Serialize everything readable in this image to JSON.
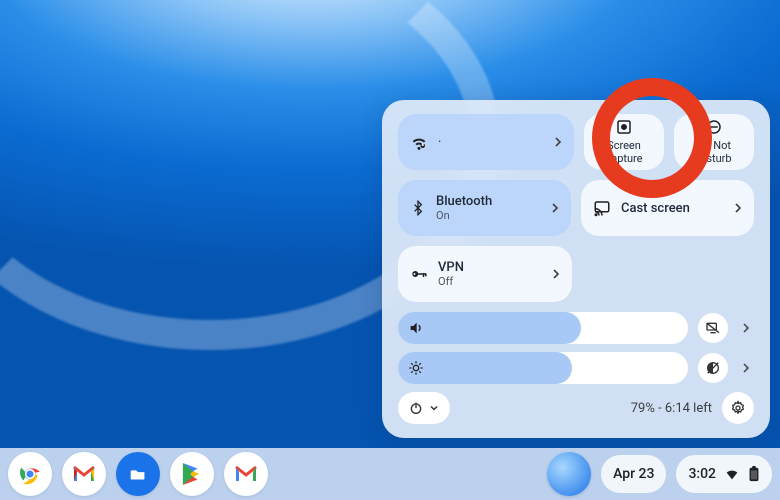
{
  "panel": {
    "tiles": {
      "wifi": {
        "name_placeholder": "·"
      },
      "screen_capture": {
        "label": "Screen capture"
      },
      "dnd": {
        "label": "Do Not Disturb"
      },
      "bluetooth": {
        "label": "Bluetooth",
        "state": "On"
      },
      "cast": {
        "label": "Cast screen"
      },
      "vpn": {
        "label": "VPN",
        "state": "Off"
      }
    },
    "battery": {
      "text": "79% - 6:14 left"
    }
  },
  "shelf": {
    "date": "Apr 23",
    "time": "3:02"
  },
  "sliders": {
    "volume_percent": 63,
    "brightness_percent": 60
  }
}
